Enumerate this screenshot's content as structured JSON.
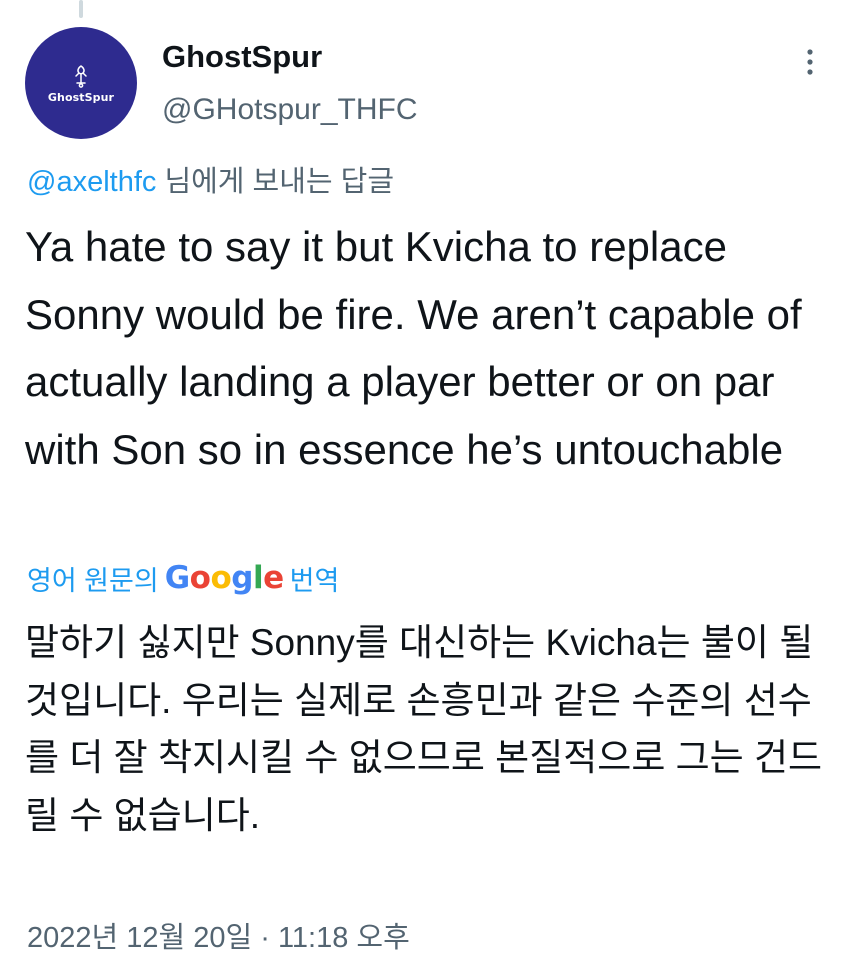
{
  "tweet": {
    "author": {
      "display_name": "GhostSpur",
      "handle": "@GHotspur_THFC",
      "avatar_text": "GhostSpur",
      "avatar_color": "#2e2b8f"
    },
    "reply_to": {
      "mention": "@axelthfc",
      "suffix": " 님에게 보내는 답글"
    },
    "text": "Ya hate to say it but Kvicha to replace Sonny would be fire. We aren’t capable of actually landing a player better or on par with Son so in essence he’s untouchable",
    "translate_bar": {
      "prefix": "영어 원문의 ",
      "google_letters": [
        "G",
        "o",
        "o",
        "g",
        "l",
        "e"
      ],
      "suffix": " 번역"
    },
    "translated_text": "말하기 싫지만 Sonny를 대신하는 Kvicha는 불이 될 것입니다. 우리는 실제로 손흥민과 같은 수준의 선수를 더 잘 착지시킬 수 없으므로 본질적으로 그는 건드릴 수 없습니다.",
    "timestamp": "2022년 12월 20일 · 11:18 오후",
    "icons": {
      "more": "more-vertical-icon",
      "logo": "spur-logo-icon"
    },
    "colors": {
      "link": "#1d9bf0",
      "secondary_text": "#536471",
      "primary_text": "#0f1419"
    }
  }
}
